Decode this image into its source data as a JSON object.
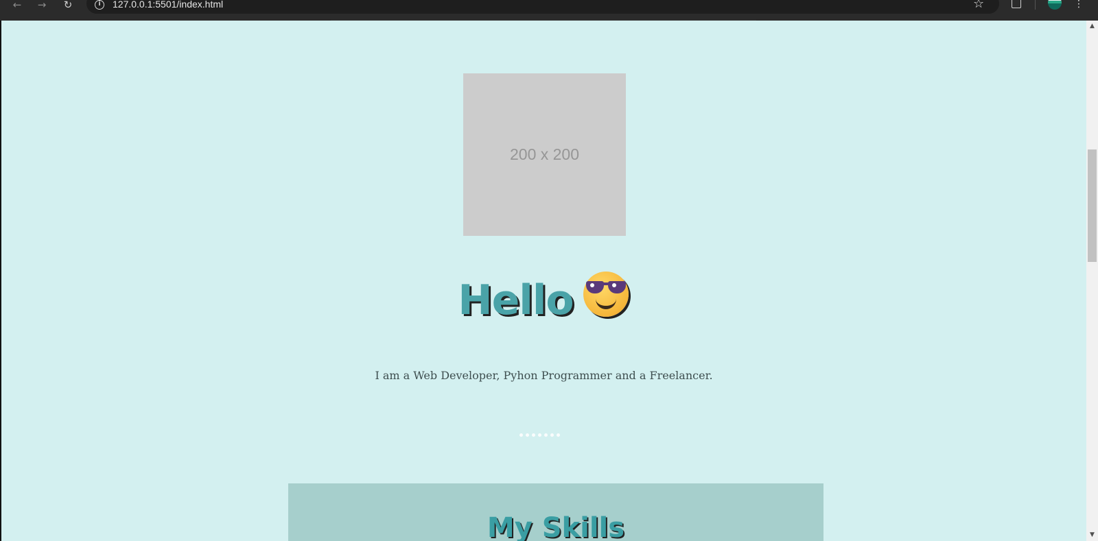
{
  "browser": {
    "url": "127.0.0.1:5501/index.html",
    "icons": {
      "back": "back-arrow-icon",
      "forward": "forward-arrow-icon",
      "reload": "reload-icon",
      "info": "site-info-icon",
      "bookmark": "star-icon",
      "extensions": "extensions-icon",
      "profile": "avatar",
      "menu": "more-vert-icon"
    }
  },
  "page": {
    "background": "#d3f0f0",
    "accent": "#4aa3a8",
    "profile_image_text": "200 x 200",
    "greeting": "Hello",
    "greeting_emoji": "smiling-face-with-sunglasses",
    "intro": "I am a Web Developer, Pyhon Programmer and a Freelancer.",
    "skills_section": {
      "background": "#a6cfcc",
      "title": "My Skills"
    }
  }
}
